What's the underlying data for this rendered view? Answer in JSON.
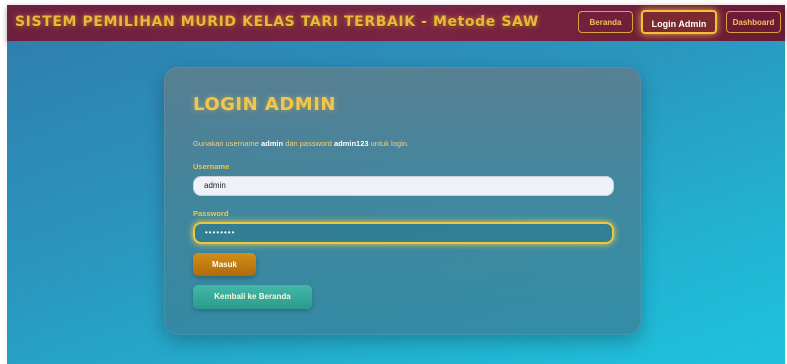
{
  "header": {
    "title": "SISTEM PEMILIHAN MURID KELAS TARI TERBAIK - Metode SAW",
    "nav": {
      "beranda": "Beranda",
      "login_admin": "Login Admin",
      "dashboard": "Dashboard"
    },
    "active_nav": "login_admin"
  },
  "login_card": {
    "title": "LOGIN ADMIN",
    "hint": {
      "prefix": "Gunakan username ",
      "username": "admin",
      "middle": " dan password ",
      "password": "admin123",
      "suffix": " untuk login."
    },
    "username_label": "Username",
    "username_value": "admin",
    "password_label": "Password",
    "password_value": "••••••••",
    "submit_label": "Masuk",
    "back_label": "Kembali ke Beranda"
  },
  "colors": {
    "header_bg": "#6e1f3f",
    "gold_accent": "#f0c23c",
    "main_bg_start": "#2f7fae",
    "main_bg_end": "#1fc2dd",
    "submit_btn": "#c27c10",
    "back_btn": "#3aab9b"
  }
}
